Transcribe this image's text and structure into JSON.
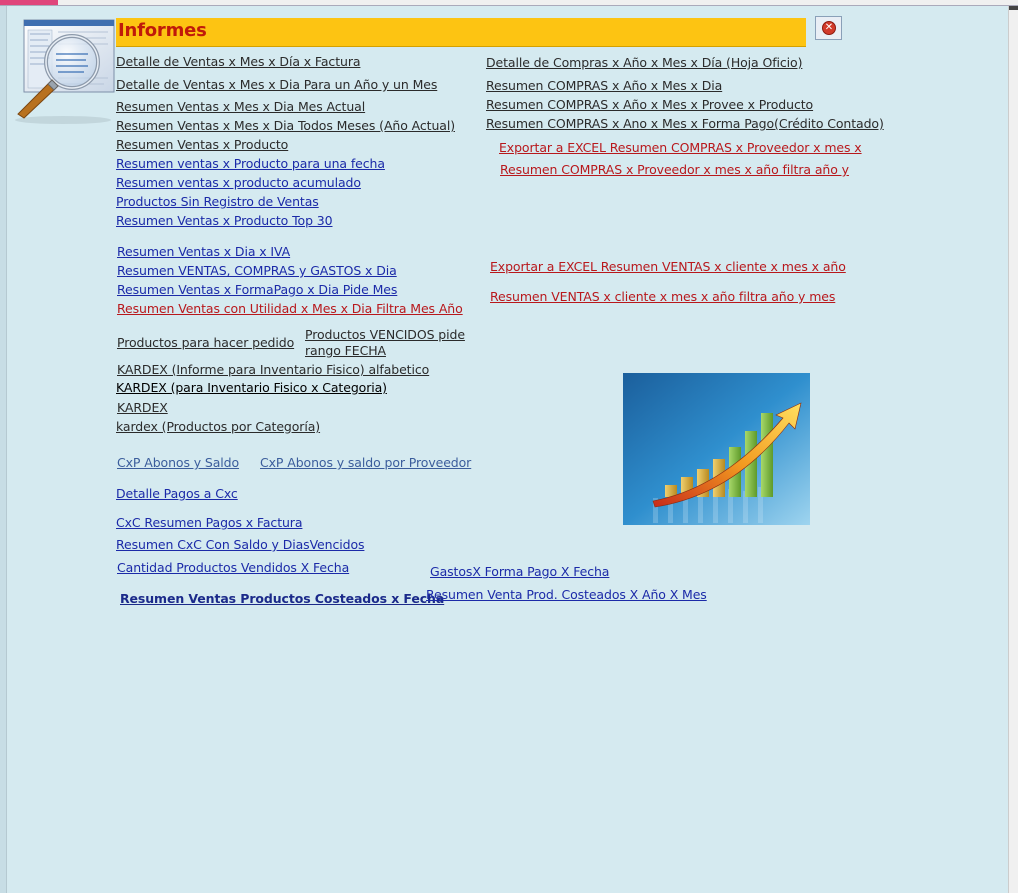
{
  "title": "Informes",
  "close_icon": "close-x-icon",
  "report_icon": "magnifier-over-document-icon",
  "chart_image": "growth-bar-chart-with-arrow",
  "left_links": [
    "Detalle de Ventas x Mes x Día x Factura",
    "Detalle de Ventas x Mes x Dia Para un Año y un Mes",
    "Resumen Ventas x Mes x Dia Mes Actual",
    "Resumen Ventas x Mes x Dia Todos Meses (Año Actual)",
    "Resumen Ventas x Producto",
    "Resumen ventas x Producto para una fecha",
    "Resumen ventas x producto acumulado",
    "Productos Sin Registro de  Ventas",
    "Resumen Ventas x Producto Top 30",
    "Resumen Ventas x Dia x IVA",
    "Resumen VENTAS, COMPRAS y GASTOS x Dia",
    "Resumen Ventas x FormaPago x Dia Pide Mes",
    "Resumen Ventas con Utilidad x Mes x Dia Filtra Mes Año",
    "Productos para hacer pedido",
    "KARDEX (Informe para Inventario Fisico) alfabetico",
    "KARDEX  (para Inventario Fisico x Categoria)",
    "KARDEX",
    "kardex (Productos por Categoría)",
    "CxP Abonos y Saldo ",
    "Detalle Pagos a Cxc",
    "CxC Resumen Pagos x Factura",
    "Resumen CxC Con Saldo y DiasVencidos",
    "Cantidad Productos Vendidos X Fecha",
    "Resumen Ventas Productos Costeados x Fecha"
  ],
  "right_links": [
    "Detalle de Compras x Año x Mes x Día (Hoja Oficio)",
    "Resumen COMPRAS x Año x Mes x Dia",
    "Resumen COMPRAS x Año x Mes x Provee x Producto",
    "Resumen COMPRAS x Ano x Mes x Forma Pago(Crédito Contado)",
    "Exportar a EXCEL Resumen COMPRAS x Proveedor x mes x ",
    "Resumen COMPRAS x Proveedor x mes x año filtra año y ",
    "Exportar a EXCEL Resumen VENTAS x cliente x mes x año",
    "Resumen VENTAS x cliente x mes x año filtra año y mes",
    "CxP Abonos y saldo por Proveedor",
    "GastosX Forma Pago X Fecha",
    "Resumen Venta Prod. Costeados X Año X Mes"
  ],
  "vencidos_lines": [
    "Productos VENCIDOS pide ",
    "rango FECHA"
  ]
}
